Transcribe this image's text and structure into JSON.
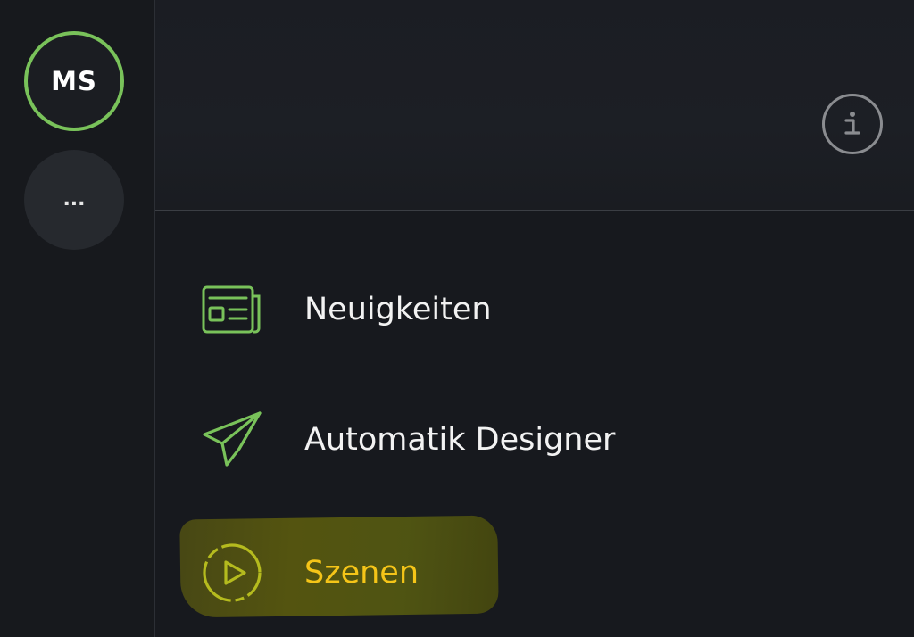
{
  "sidebar": {
    "avatar": {
      "initials": "MS"
    },
    "more_button": {
      "label": "..."
    }
  },
  "header": {
    "info_icon": "info-icon"
  },
  "menu": {
    "items": [
      {
        "label": "Neuigkeiten",
        "icon": "newspaper-icon"
      },
      {
        "label": "Automatik Designer",
        "icon": "paper-plane-icon"
      },
      {
        "label": "Szenen",
        "icon": "play-circle-icon",
        "highlighted": true
      }
    ]
  },
  "colors": {
    "accent_green": "#79c25a",
    "highlight_yellow": "#f5c518",
    "background": "#17191e"
  }
}
